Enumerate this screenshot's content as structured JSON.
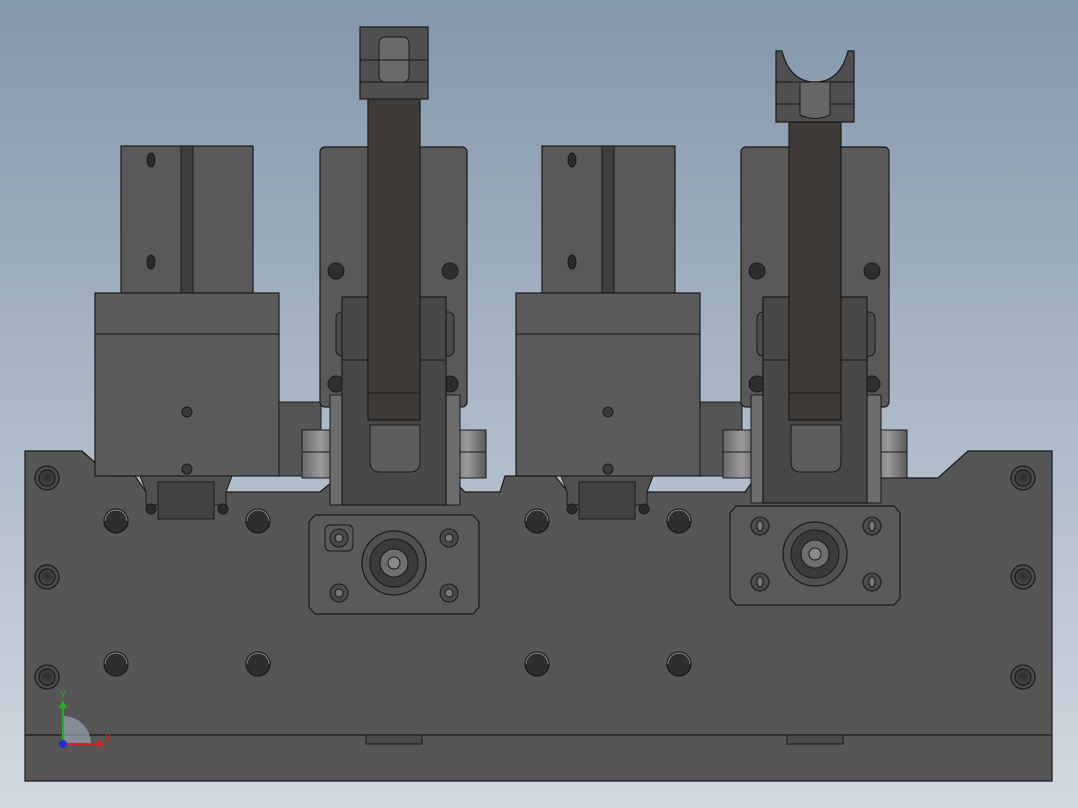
{
  "viewport": {
    "background_top": "#8497ab",
    "background_bottom": "#d2d9e1",
    "part_fill": "#585858",
    "part_dark": "#3e3b38",
    "edge_color": "#1a1a1a"
  },
  "triad": {
    "x_label": "X",
    "y_label": "Y",
    "x_color": "#e02020",
    "y_color": "#20b020",
    "z_color": "#2030d0"
  }
}
